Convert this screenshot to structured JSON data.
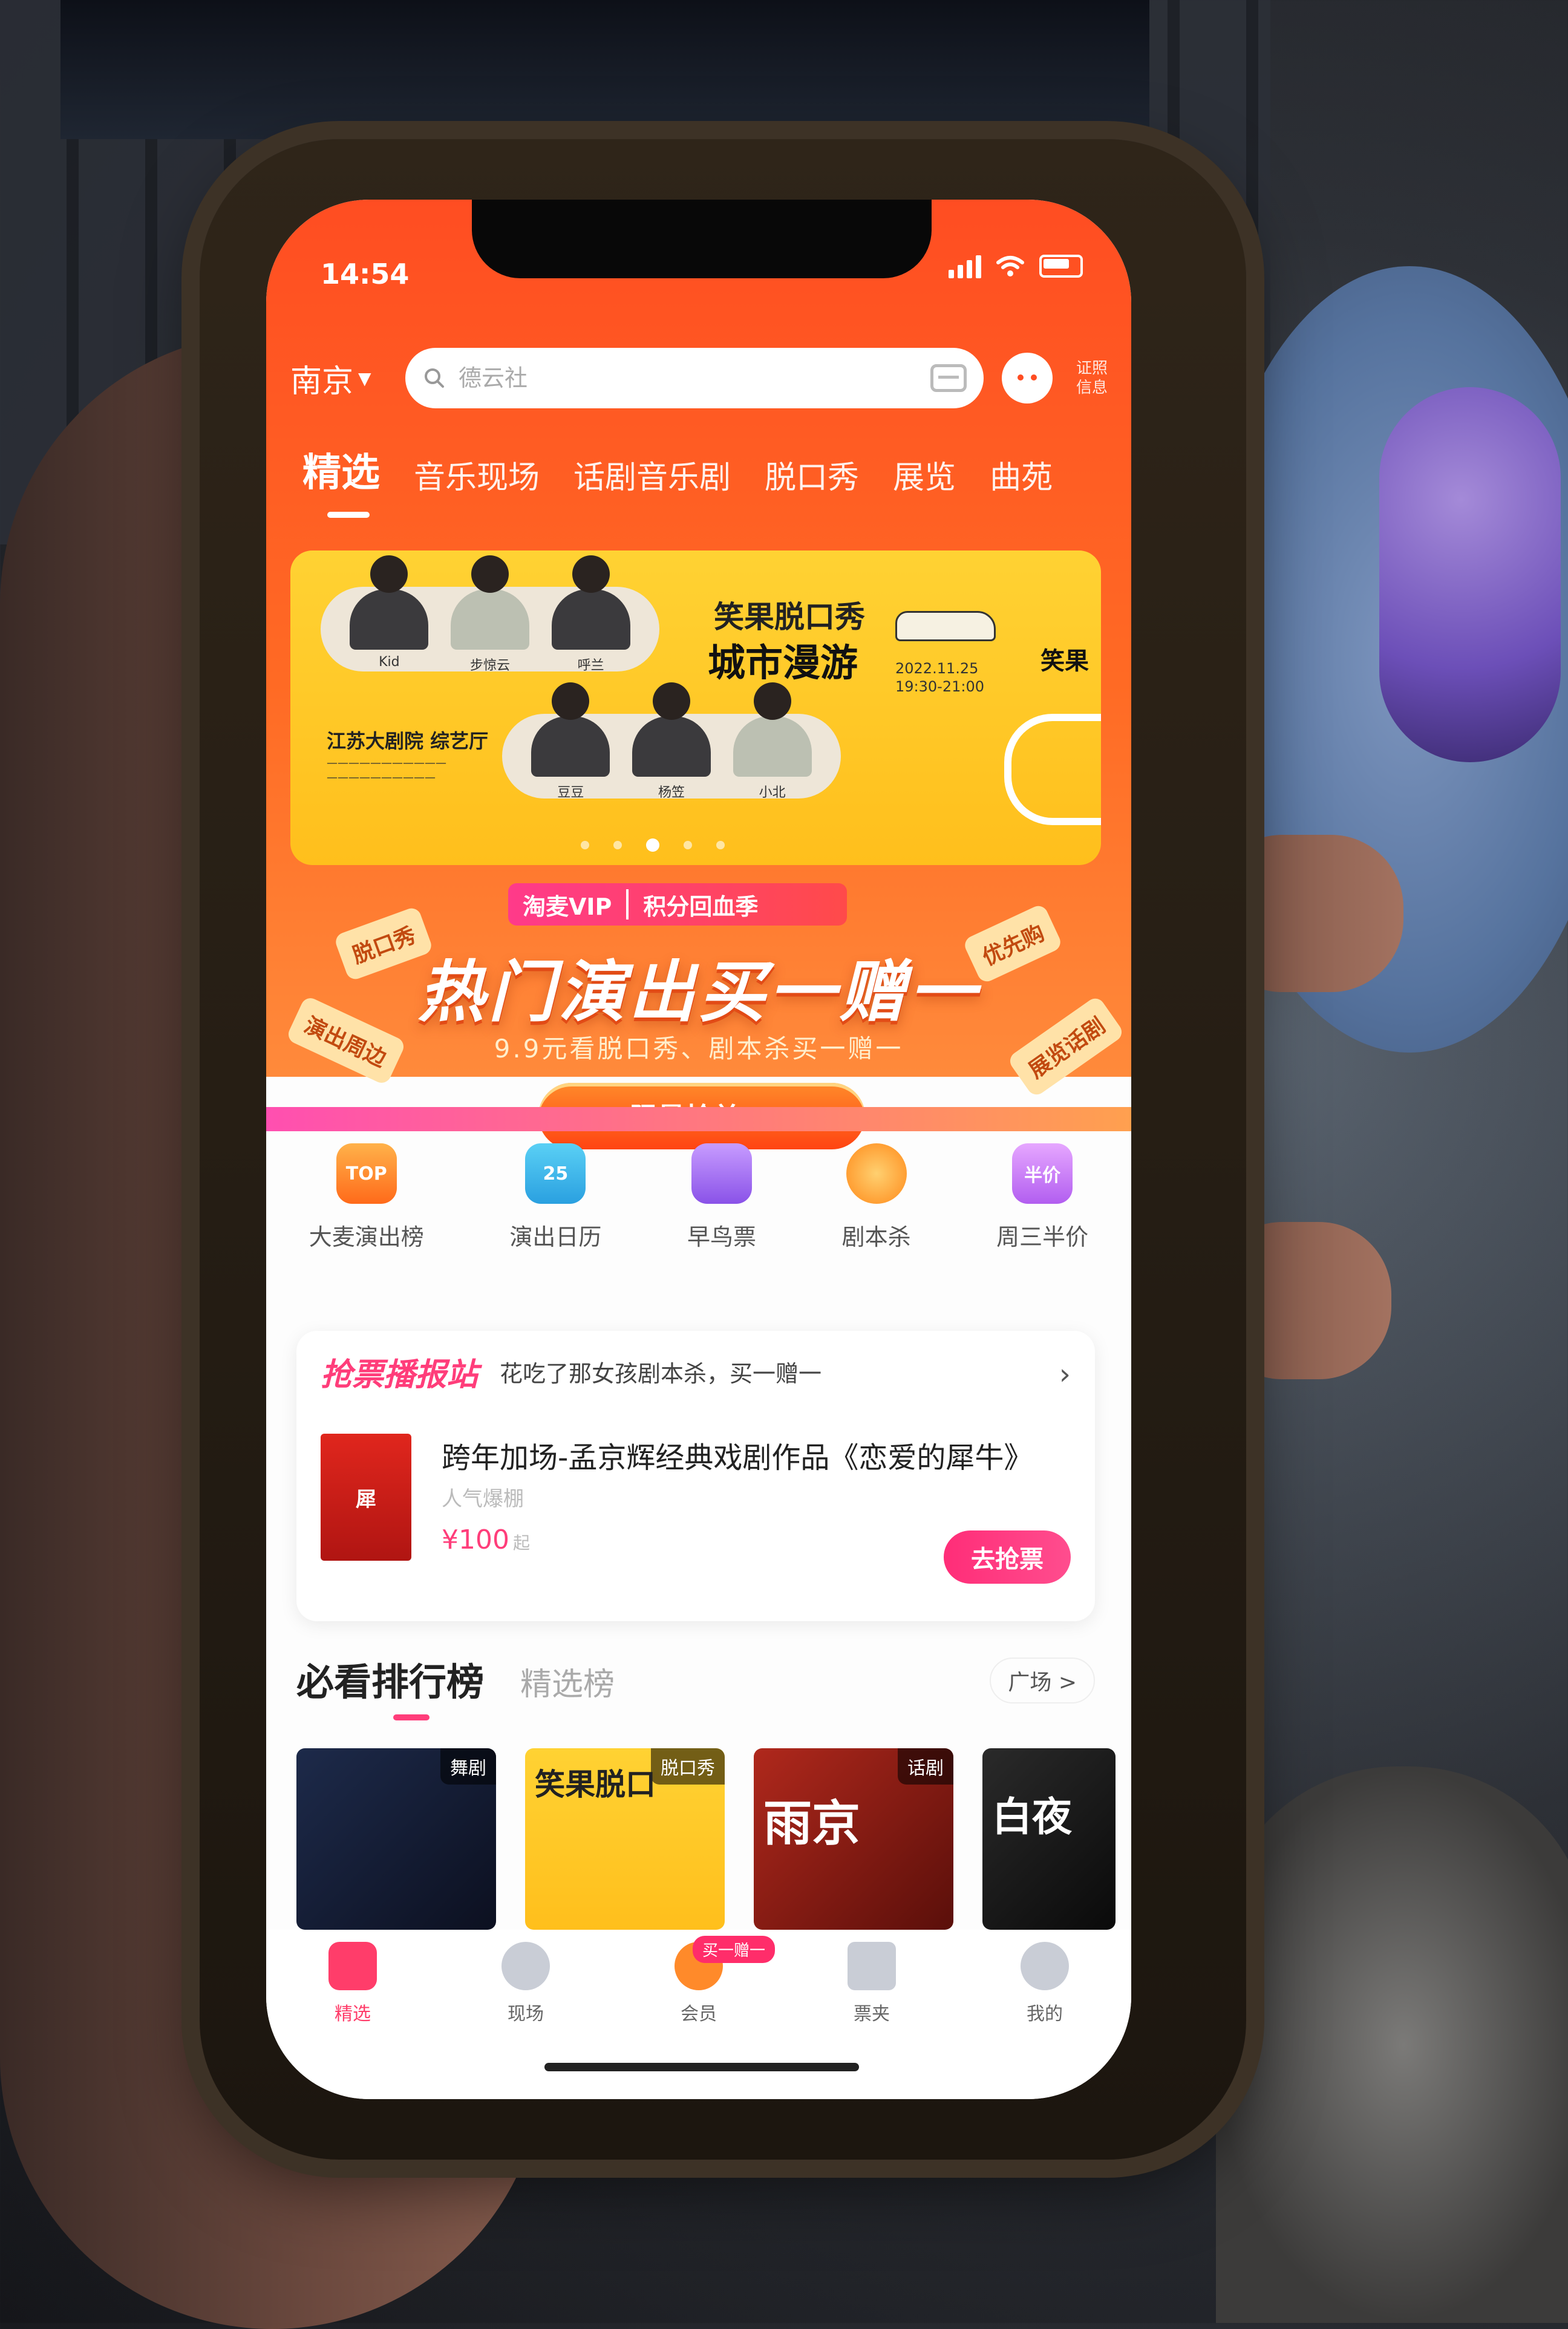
{
  "status": {
    "time": "14:54"
  },
  "header": {
    "city": "南京",
    "search_placeholder": "德云社",
    "cert_label": "证照信息"
  },
  "tabs": [
    "精选",
    "音乐现场",
    "话剧音乐剧",
    "脱口秀",
    "展览",
    "曲苑"
  ],
  "banner": {
    "title_line1": "笑果脱口秀",
    "title_line2": "城市漫游",
    "date": "2022.11.25",
    "time": "19:30-21:00",
    "logo": "笑果",
    "venue": "江苏大剧院 综艺厅",
    "top_performers": [
      "Kid",
      "步惊云",
      "呼兰"
    ],
    "bottom_performers": [
      "豆豆",
      "杨笠",
      "小北"
    ]
  },
  "promo": {
    "vip_label": "淘麦VIP",
    "season_label": "积分回血季",
    "title": "热门演出买一赠一",
    "subtitle": "9.9元看脱口秀、剧本杀买一赠一",
    "button": "限量抢兑 >",
    "tags": [
      "脱口秀",
      "演出周边",
      "优先购",
      "展览话剧"
    ]
  },
  "quick_links": [
    {
      "label": "大麦演出榜",
      "icon": "top-rank-icon",
      "badge": "TOP",
      "color": "#ff8a2a"
    },
    {
      "label": "演出日历",
      "icon": "calendar-icon",
      "badge": "25",
      "color": "#35b6e8"
    },
    {
      "label": "早鸟票",
      "icon": "early-bird-ticket-icon",
      "badge": "",
      "color": "#a66ef0"
    },
    {
      "label": "剧本杀",
      "icon": "script-game-icon",
      "badge": "",
      "color": "#ff9a2a"
    },
    {
      "label": "周三半价",
      "icon": "half-price-icon",
      "badge": "半价",
      "color": "#c86ff0"
    }
  ],
  "ticket_card": {
    "brand": "抢票播报站",
    "news": "花吃了那女孩剧本杀，买一赠一",
    "show_title": "跨年加场-孟京辉经典戏剧作品《恋爱的犀牛》",
    "tag": "人气爆棚",
    "price": "¥100",
    "price_suffix": "起",
    "button": "去抢票"
  },
  "ranking": {
    "title": "必看排行榜",
    "tab2": "精选榜",
    "plaza": "广场 >",
    "cards": [
      {
        "badge": "舞剧",
        "word": ""
      },
      {
        "badge": "脱口秀",
        "word": "笑果脱口"
      },
      {
        "badge": "话剧",
        "word": "雨京"
      },
      {
        "badge": "",
        "word": "白夜"
      }
    ]
  },
  "tabbar": [
    {
      "label": "精选",
      "icon": "home-icon"
    },
    {
      "label": "现场",
      "icon": "live-icon"
    },
    {
      "label": "会员",
      "icon": "vip-heart-icon",
      "promo": "买一赠一"
    },
    {
      "label": "票夹",
      "icon": "ticket-wallet-icon"
    },
    {
      "label": "我的",
      "icon": "profile-icon"
    }
  ]
}
